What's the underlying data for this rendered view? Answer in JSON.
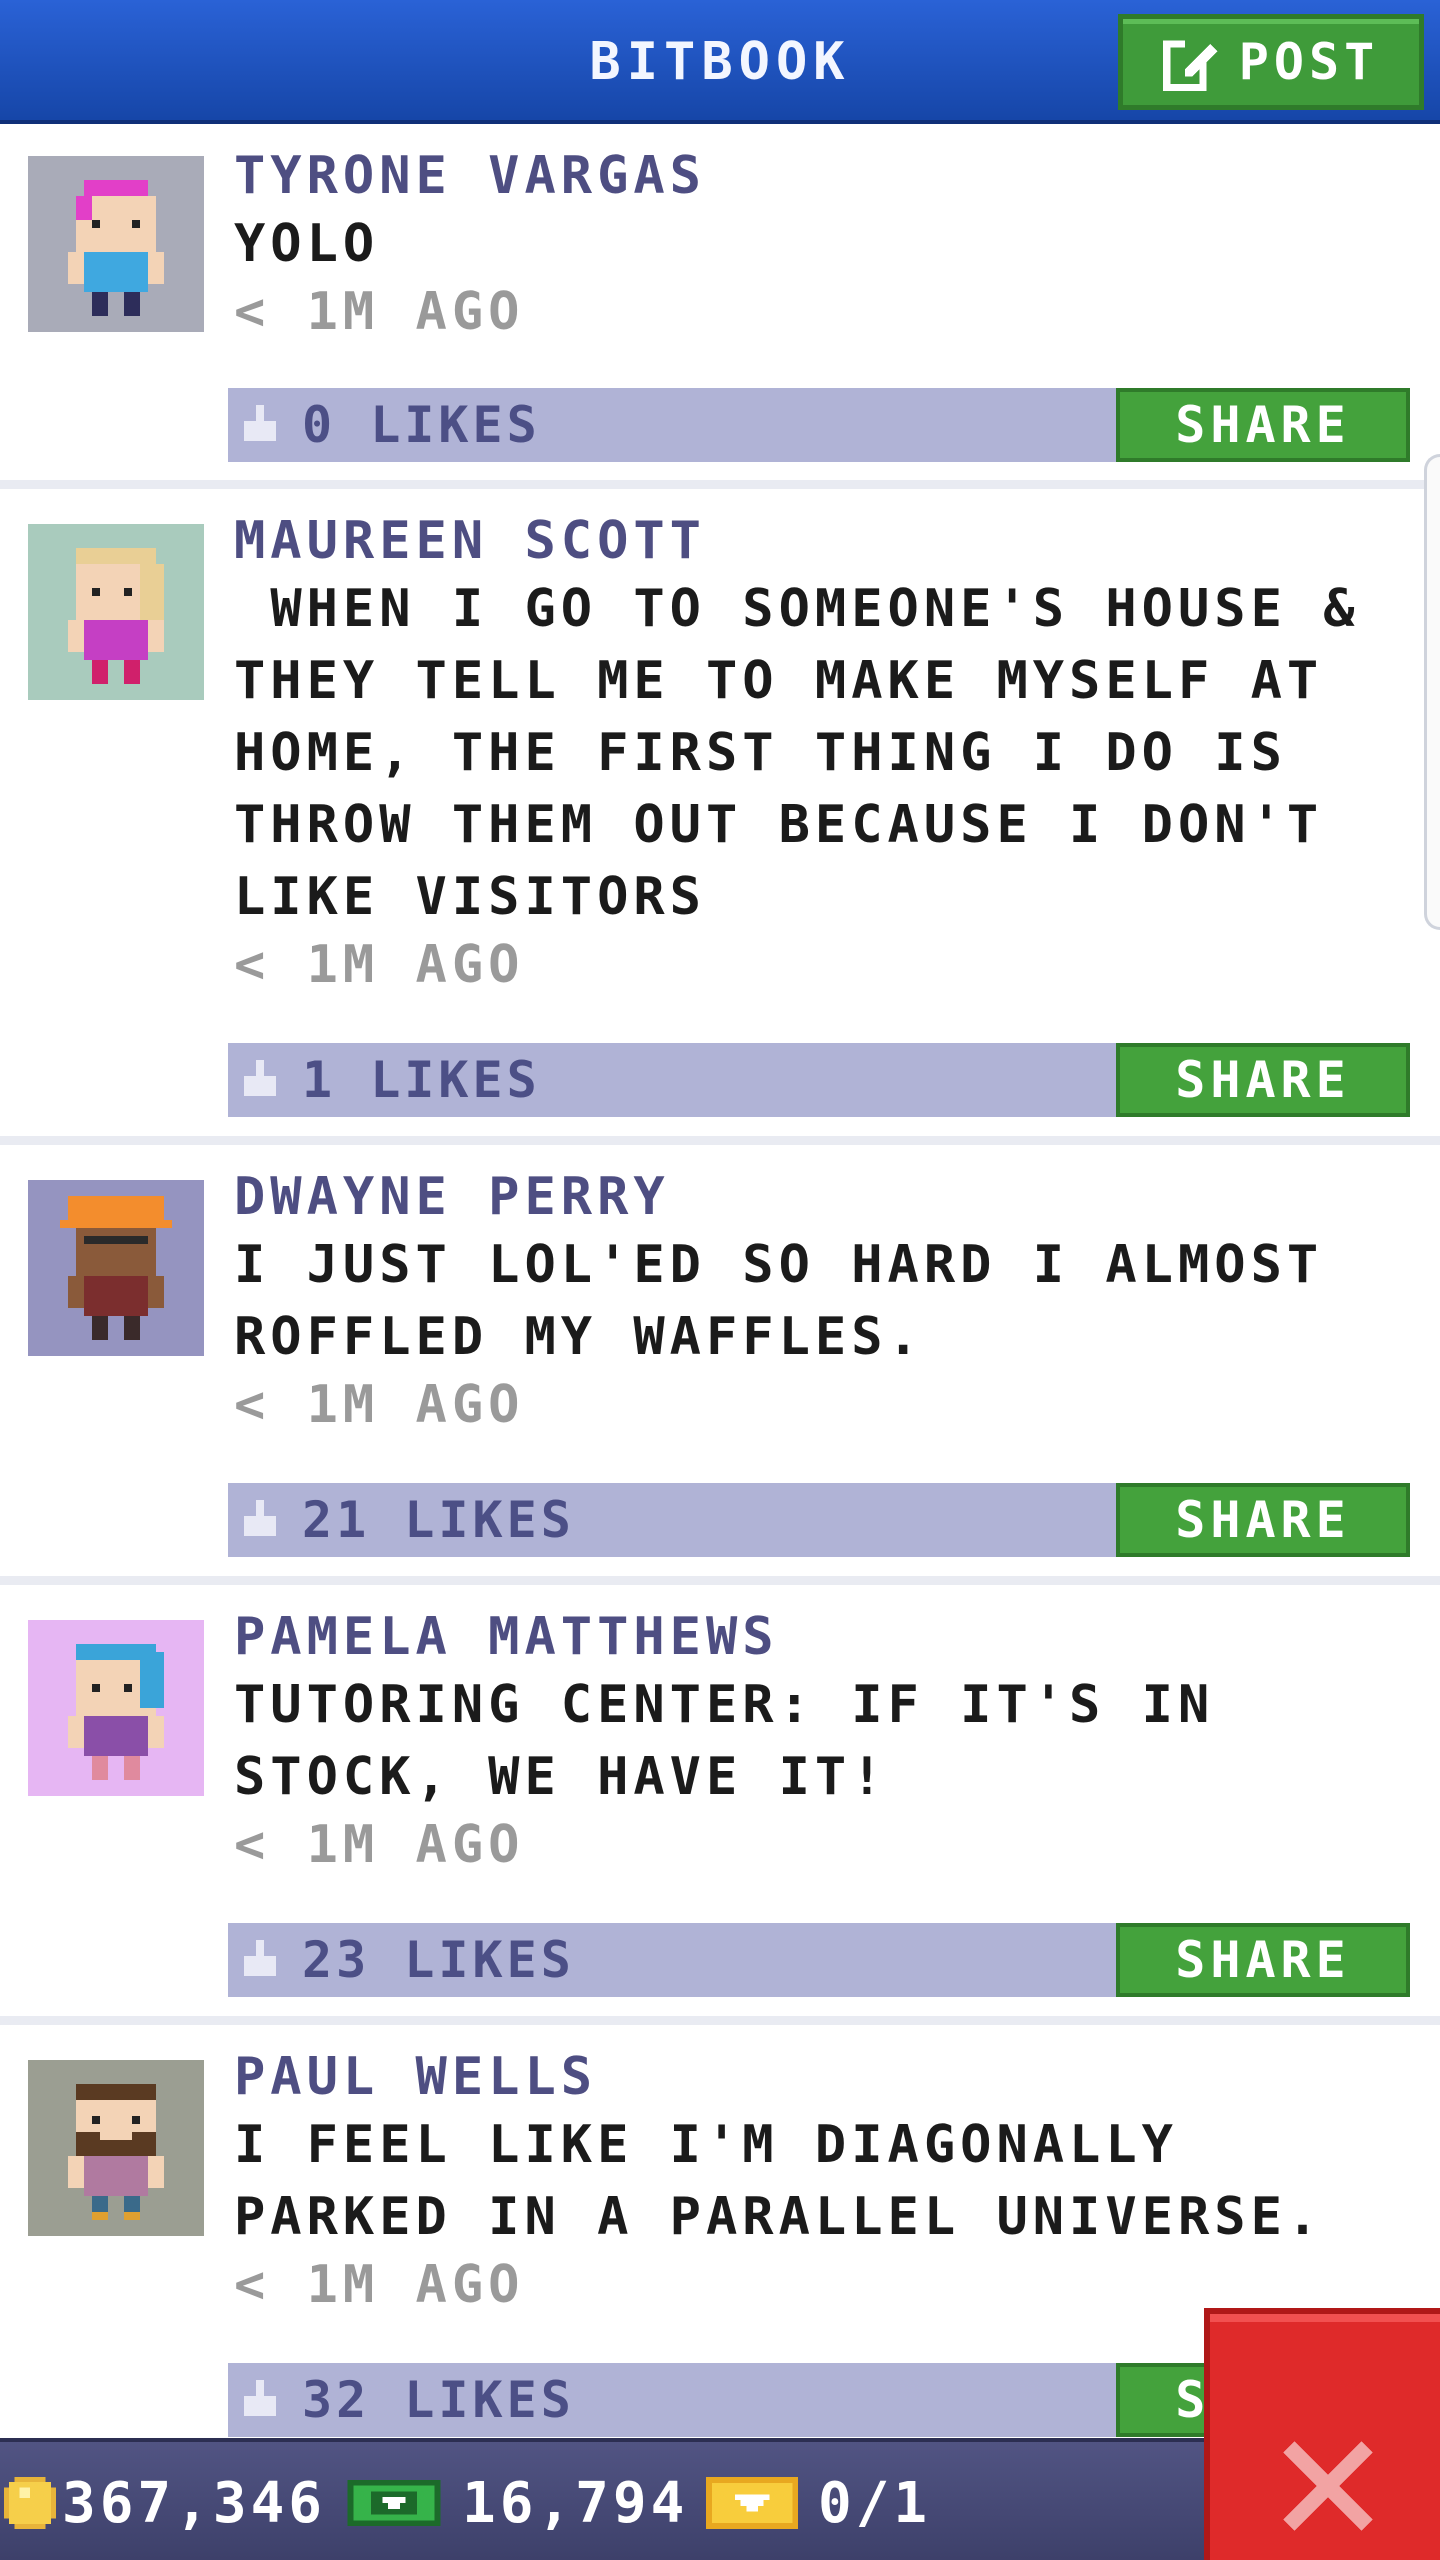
{
  "header": {
    "title": "BITBOOK",
    "post_label": "POST"
  },
  "feed": {
    "share_label": "SHARE",
    "posts": [
      {
        "author": "TYRONE VARGAS",
        "text": "YOLO",
        "time": "< 1M AGO",
        "likes": "0 LIKES",
        "avatar": {
          "bg": "#a9abb8",
          "hair": "#e23fc8",
          "skin": "#f3d3b6",
          "shirt": "#3fa8e0",
          "pants": "#2d2d5a"
        }
      },
      {
        "author": "MAUREEN SCOTT",
        "text": " WHEN I GO TO SOMEONE'S HOUSE & THEY TELL ME TO MAKE MYSELF AT HOME, THE FIRST THING I DO IS THROW THEM OUT BECAUSE I DON'T LIKE VISITORS",
        "time": "< 1M AGO",
        "likes": "1 LIKES",
        "avatar": {
          "bg": "#a9cbbd",
          "hair": "#e9cf95",
          "skin": "#f3d3b6",
          "shirt": "#c53fc4",
          "pants": "#d0206b"
        }
      },
      {
        "author": "DWAYNE PERRY",
        "text": "I JUST LOL'ED SO HARD I ALMOST ROFFLED MY WAFFLES.",
        "time": "< 1M AGO",
        "likes": "21 LIKES",
        "avatar": {
          "bg": "#9594c0",
          "hair": "#f38d2d",
          "skin": "#8a5a3a",
          "shirt": "#7b2e2e",
          "pants": "#3a2a2a"
        }
      },
      {
        "author": "PAMELA MATTHEWS",
        "text": "TUTORING CENTER: IF IT'S IN STOCK, WE HAVE IT!",
        "time": "< 1M AGO",
        "likes": "23 LIKES",
        "avatar": {
          "bg": "#e6b6f3",
          "hair": "#3aa4d9",
          "skin": "#f3d3b6",
          "shirt": "#8a4fa8",
          "pants": "#e08a9e"
        }
      },
      {
        "author": "PAUL WELLS",
        "text": "I FEEL LIKE I'M DIAGONALLY PARKED IN A PARALLEL UNIVERSE.",
        "time": "< 1M AGO",
        "likes": "32 LIKES",
        "avatar": {
          "bg": "#9b9e92",
          "hair": "#5a3a22",
          "skin": "#f3d3b6",
          "shirt": "#b07aa0",
          "pants": "#3a6a8a"
        }
      }
    ]
  },
  "status": {
    "coins": "367,346",
    "cash": "16,794",
    "tickets": "0/1"
  },
  "colors": {
    "header": "#1f54c4",
    "share_green": "#44a23c",
    "like_bar": "#b0b3d6",
    "author": "#4e4e82",
    "close_red": "#df2a2a"
  },
  "icons": {
    "post": "edit-icon",
    "like": "thumbs-up-icon",
    "coin": "coin-icon",
    "cash": "cash-icon",
    "ticket": "ticket-icon",
    "close": "close-icon"
  }
}
